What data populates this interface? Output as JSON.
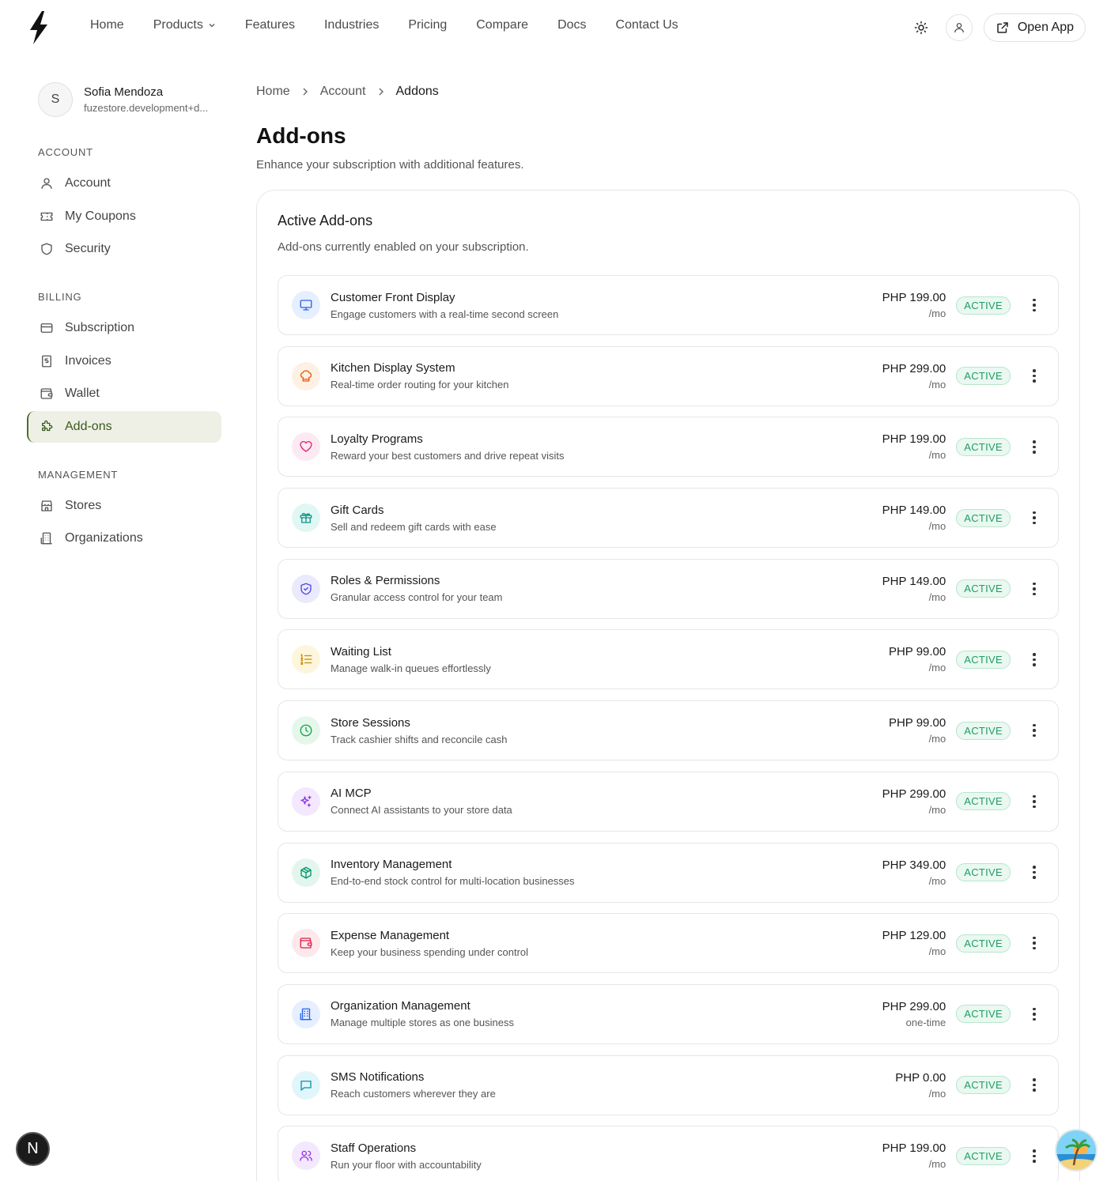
{
  "nav": {
    "links": [
      "Home",
      "Products",
      "Features",
      "Industries",
      "Pricing",
      "Compare",
      "Docs",
      "Contact Us"
    ],
    "open_app_label": "Open App"
  },
  "profile": {
    "initial": "S",
    "name": "Sofia Mendoza",
    "email": "fuzestore.development+d..."
  },
  "sidebar": {
    "sections": [
      {
        "title": "ACCOUNT",
        "items": [
          {
            "label": "Account",
            "icon": "user-icon"
          },
          {
            "label": "My Coupons",
            "icon": "ticket-icon"
          },
          {
            "label": "Security",
            "icon": "shield-icon"
          }
        ]
      },
      {
        "title": "BILLING",
        "items": [
          {
            "label": "Subscription",
            "icon": "credit-card-icon"
          },
          {
            "label": "Invoices",
            "icon": "receipt-icon"
          },
          {
            "label": "Wallet",
            "icon": "wallet-icon"
          },
          {
            "label": "Add-ons",
            "icon": "puzzle-icon",
            "active": true
          }
        ]
      },
      {
        "title": "MANAGEMENT",
        "items": [
          {
            "label": "Stores",
            "icon": "store-icon"
          },
          {
            "label": "Organizations",
            "icon": "building-icon"
          }
        ]
      }
    ]
  },
  "breadcrumb": [
    "Home",
    "Account",
    "Addons"
  ],
  "page": {
    "title": "Add-ons",
    "subtitle": "Enhance your subscription with additional features."
  },
  "card": {
    "title": "Active Add-ons",
    "subtitle": "Add-ons currently enabled on your subscription."
  },
  "addons": [
    {
      "name": "Customer Front Display",
      "desc": "Engage customers with a real-time second screen",
      "price": "PHP 199.00",
      "period": "/mo",
      "status": "ACTIVE",
      "icon": "monitor-icon",
      "color": "#2563eb",
      "bg": "#e6efff"
    },
    {
      "name": "Kitchen Display System",
      "desc": "Real-time order routing for your kitchen",
      "price": "PHP 299.00",
      "period": "/mo",
      "status": "ACTIVE",
      "icon": "chef-hat-icon",
      "color": "#ea580c",
      "bg": "#fff0e4"
    },
    {
      "name": "Loyalty Programs",
      "desc": "Reward your best customers and drive repeat visits",
      "price": "PHP 199.00",
      "period": "/mo",
      "status": "ACTIVE",
      "icon": "heart-icon",
      "color": "#db2777",
      "bg": "#fde9f2"
    },
    {
      "name": "Gift Cards",
      "desc": "Sell and redeem gift cards with ease",
      "price": "PHP 149.00",
      "period": "/mo",
      "status": "ACTIVE",
      "icon": "gift-icon",
      "color": "#0d9488",
      "bg": "#e1f7f3"
    },
    {
      "name": "Roles & Permissions",
      "desc": "Granular access control for your team",
      "price": "PHP 149.00",
      "period": "/mo",
      "status": "ACTIVE",
      "icon": "shield-check-icon",
      "color": "#4f46e5",
      "bg": "#ebeafd"
    },
    {
      "name": "Waiting List",
      "desc": "Manage walk-in queues effortlessly",
      "price": "PHP 99.00",
      "period": "/mo",
      "status": "ACTIVE",
      "icon": "list-ordered-icon",
      "color": "#ca8a04",
      "bg": "#fdf6dc"
    },
    {
      "name": "Store Sessions",
      "desc": "Track cashier shifts and reconcile cash",
      "price": "PHP 99.00",
      "period": "/mo",
      "status": "ACTIVE",
      "icon": "clock-icon",
      "color": "#16a34a",
      "bg": "#e5f7ea"
    },
    {
      "name": "AI MCP",
      "desc": "Connect AI assistants to your store data",
      "price": "PHP 299.00",
      "period": "/mo",
      "status": "ACTIVE",
      "icon": "sparkles-icon",
      "color": "#9333ea",
      "bg": "#f3e8fd"
    },
    {
      "name": "Inventory Management",
      "desc": "End-to-end stock control for multi-location businesses",
      "price": "PHP 349.00",
      "period": "/mo",
      "status": "ACTIVE",
      "icon": "package-icon",
      "color": "#059669",
      "bg": "#e2f6ee"
    },
    {
      "name": "Expense Management",
      "desc": "Keep your business spending under control",
      "price": "PHP 129.00",
      "period": "/mo",
      "status": "ACTIVE",
      "icon": "wallet-icon",
      "color": "#e11d48",
      "bg": "#fde8ec"
    },
    {
      "name": "Organization Management",
      "desc": "Manage multiple stores as one business",
      "price": "PHP 299.00",
      "period": "one-time",
      "status": "ACTIVE",
      "icon": "building-icon",
      "color": "#2563eb",
      "bg": "#e6efff"
    },
    {
      "name": "SMS Notifications",
      "desc": "Reach customers wherever they are",
      "price": "PHP 0.00",
      "period": "/mo",
      "status": "ACTIVE",
      "icon": "message-square-icon",
      "color": "#0891b2",
      "bg": "#e0f6fa"
    },
    {
      "name": "Staff Operations",
      "desc": "Run your floor with accountability",
      "price": "PHP 199.00",
      "period": "/mo",
      "status": "ACTIVE",
      "icon": "users-icon",
      "color": "#9333ea",
      "bg": "#f3e8fd"
    }
  ],
  "floating": {
    "dev_badge": "N"
  }
}
